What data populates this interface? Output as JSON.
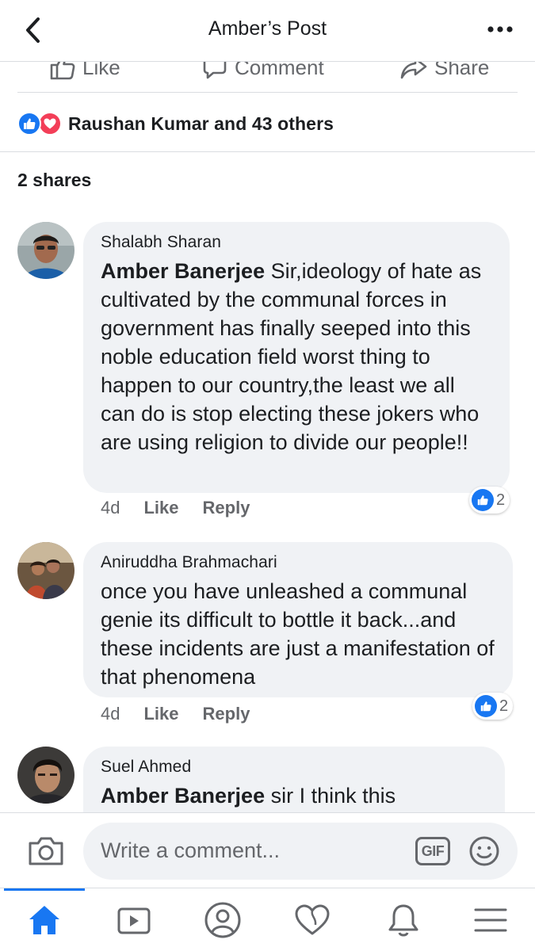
{
  "header": {
    "title": "Amber’s Post"
  },
  "actions": {
    "like_label": "Like",
    "comment_label": "Comment",
    "share_label": "Share"
  },
  "reactions": {
    "summary": "Raushan Kumar and 43 others"
  },
  "shares": {
    "text": "2 shares"
  },
  "comments": [
    {
      "author": "Shalabh Sharan",
      "mention": "Amber Banerjee",
      "text": " Sir,ideology of hate as cultivated by the communal forces in government has finally seeped into this noble education field worst thing to happen to our country,the least we all can do is stop electing these jokers who are using religion to divide our people!!",
      "time": "4d",
      "like_label": "Like",
      "reply_label": "Reply",
      "like_count": "2"
    },
    {
      "author": "Aniruddha Brahmachari",
      "mention": "",
      "text": "once you have unleashed a communal genie its difficult to bottle it back...and these incidents are just a manifestation of that phenomena",
      "time": "4d",
      "like_label": "Like",
      "reply_label": "Reply",
      "like_count": "2"
    },
    {
      "author": "Suel Ahmed",
      "mention": "Amber Banerjee",
      "text": " sir I think this",
      "time": "",
      "like_label": "",
      "reply_label": "",
      "like_count": ""
    }
  ],
  "composer": {
    "placeholder": "Write a comment...",
    "gif_label": "GIF"
  },
  "nav": {
    "items": [
      "home-icon",
      "watch-icon",
      "profile-icon",
      "dating-icon",
      "notifications-icon",
      "menu-icon"
    ],
    "active": "home-icon"
  },
  "colors": {
    "accent": "#1877f2",
    "love": "#f33e58",
    "bubble": "#f0f2f5",
    "secondary_text": "#65676b"
  }
}
